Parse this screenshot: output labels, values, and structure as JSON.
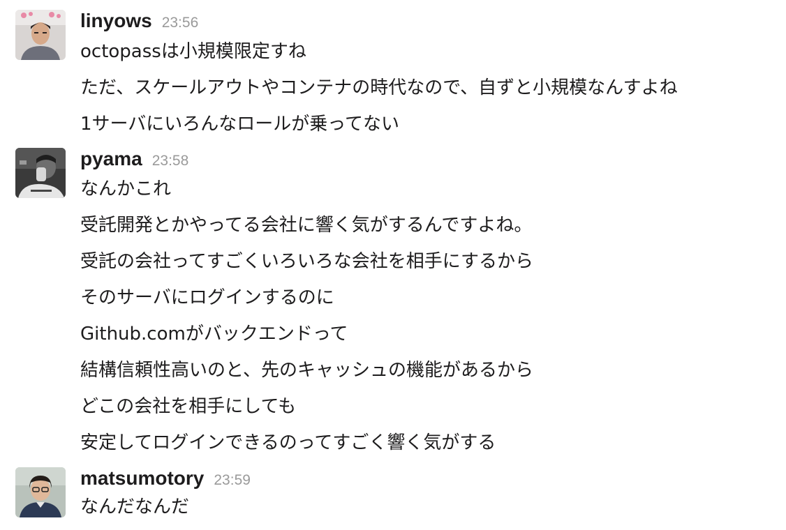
{
  "messages": [
    {
      "user": "linyows",
      "time": "23:56",
      "avatar": "avatar-linyows",
      "lines": [
        "octopassは小規模限定すね",
        "ただ、スケールアウトやコンテナの時代なので、自ずと小規模なんすよね",
        "1サーバにいろんなロールが乗ってない"
      ]
    },
    {
      "user": "pyama",
      "time": "23:58",
      "avatar": "avatar-pyama",
      "lines": [
        "なんかこれ",
        "受託開発とかやってる会社に響く気がするんですよね。",
        "受託の会社ってすごくいろいろな会社を相手にするから",
        "そのサーバにログインするのに",
        "Github.comがバックエンドって",
        "結構信頼性高いのと、先のキャッシュの機能があるから",
        "どこの会社を相手にしても",
        "安定してログインできるのってすごく響く気がする"
      ]
    },
    {
      "user": "matsumotory",
      "time": "23:59",
      "avatar": "avatar-matsumotory",
      "lines": [
        "なんだなんだ"
      ]
    }
  ]
}
